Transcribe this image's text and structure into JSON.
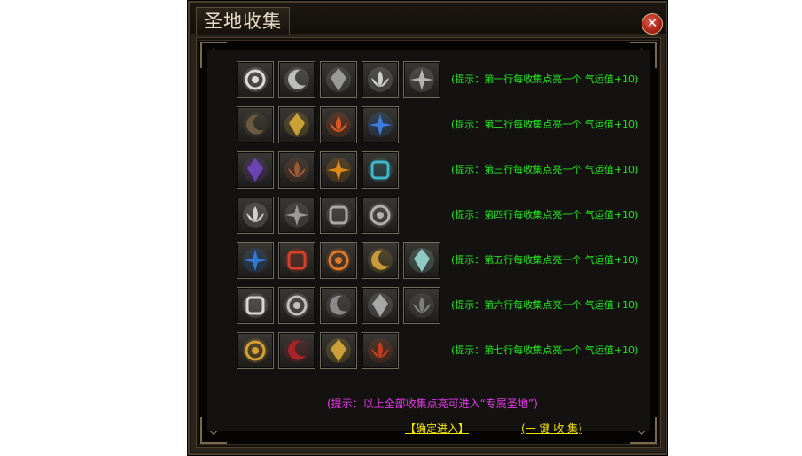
{
  "window": {
    "title": "圣地收集",
    "close_label": "✕"
  },
  "rows": [
    {
      "hint": "(提示：第一行每收集点亮一个 气运值+10)",
      "items": [
        {
          "icon": "swirl-orb-icon",
          "color": "#dcdcdc"
        },
        {
          "icon": "crescent-moon-icon",
          "color": "#bdbdbd"
        },
        {
          "icon": "crystal-shard-icon",
          "color": "#a9a9a9"
        },
        {
          "icon": "lotus-flower-icon",
          "color": "#cfcfcf"
        },
        {
          "icon": "lotus-bloom-icon",
          "color": "#b5b5b5"
        }
      ]
    },
    {
      "hint": "(提示：第二行每收集点亮一个 气运值+10)",
      "items": [
        {
          "icon": "faded-rune-icon",
          "color": "#6a5a40"
        },
        {
          "icon": "golden-cross-orb-icon",
          "color": "#e0b23a"
        },
        {
          "icon": "fire-flame-icon",
          "color": "#e0561c"
        },
        {
          "icon": "blue-flame-icon",
          "color": "#3c7de0"
        }
      ]
    },
    {
      "hint": "(提示：第三行每收集点亮一个 气运值+10)",
      "items": [
        {
          "icon": "purple-rune-icon",
          "color": "#7446c8"
        },
        {
          "icon": "bronze-rune-stone-icon",
          "color": "#9b5a3a"
        },
        {
          "icon": "flaming-sword-icon",
          "color": "#e08a1c"
        },
        {
          "icon": "crystal-sword-icon",
          "color": "#3fb6c9"
        }
      ]
    },
    {
      "hint": "(提示：第四行每收集点亮一个 气运值+10)",
      "items": [
        {
          "icon": "scroll-charm-icon",
          "color": "#cfcfcf"
        },
        {
          "icon": "scroll-charm-faded-icon",
          "color": "#9a9a9a"
        },
        {
          "icon": "scroll-rune-icon",
          "color": "#a8a8a8"
        },
        {
          "icon": "scroll-seal-icon",
          "color": "#b0b0b0"
        }
      ]
    },
    {
      "hint": "(提示：第五行每收集点亮一个 气运值+10)",
      "items": [
        {
          "icon": "blue-gem-icon",
          "color": "#2f7ad8"
        },
        {
          "icon": "red-gem-icon",
          "color": "#d8402a"
        },
        {
          "icon": "orange-gem-icon",
          "color": "#e07a26"
        },
        {
          "icon": "golden-spider-icon",
          "color": "#c99a3a"
        },
        {
          "icon": "frost-crystal-icon",
          "color": "#9ee0d8"
        }
      ]
    },
    {
      "hint": "(提示：第六行每收集点亮一个 气运值+10)",
      "items": [
        {
          "icon": "white-flame-icon",
          "color": "#d8d8d8"
        },
        {
          "icon": "spirit-flame-icon",
          "color": "#c0c0c0"
        },
        {
          "icon": "dark-crown-icon",
          "color": "#8a8a8a"
        },
        {
          "icon": "silver-gem-icon",
          "color": "#b8b8b8"
        },
        {
          "icon": "dark-lotus-icon",
          "color": "#7d7d7d"
        }
      ]
    },
    {
      "hint": "(提示：第七行每收集点亮一个 气运值+10)",
      "items": [
        {
          "icon": "dragon-amulet-icon",
          "color": "#d8a030"
        },
        {
          "icon": "crimson-armor-icon",
          "color": "#a8242a"
        },
        {
          "icon": "golden-shield-icon",
          "color": "#e0b03a"
        },
        {
          "icon": "ruby-gauntlet-icon",
          "color": "#c0401c"
        }
      ]
    }
  ],
  "footer": {
    "note": "(提示：以上全部收集点亮可进入“专属圣地”)",
    "enter_label": "【确定进入】",
    "collect_label": "(一 键 收 集)"
  }
}
